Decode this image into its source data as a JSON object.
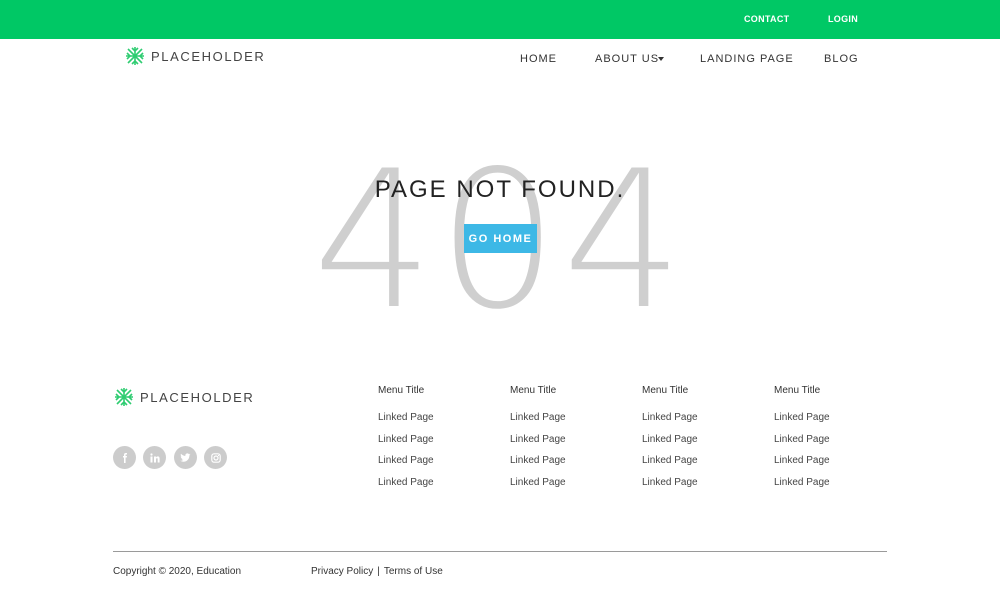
{
  "topbar": {
    "contact": "CONTACT",
    "login": "LOGIN"
  },
  "brand": {
    "name": "PLACEHOLDER",
    "icon": "logo-snowflake-icon"
  },
  "nav": {
    "items": [
      {
        "label": "HOME"
      },
      {
        "label": "ABOUT US",
        "icon": "caret-down-icon"
      },
      {
        "label": "LANDING PAGE"
      },
      {
        "label": "BLOG"
      }
    ]
  },
  "hero": {
    "code": "404",
    "message": "PAGE NOT FOUND.",
    "button": "GO HOME"
  },
  "social": [
    "facebook-icon",
    "linkedin-icon",
    "twitter-icon",
    "instagram-icon"
  ],
  "footer": {
    "columns": [
      {
        "title": "Menu Title",
        "links": [
          "Linked Page",
          "Linked Page",
          "Linked Page",
          "Linked Page"
        ]
      },
      {
        "title": "Menu Title",
        "links": [
          "Linked Page",
          "Linked Page",
          "Linked Page",
          "Linked Page"
        ]
      },
      {
        "title": "Menu Title",
        "links": [
          "Linked Page",
          "Linked Page",
          "Linked Page",
          "Linked Page"
        ]
      },
      {
        "title": "Menu Title",
        "links": [
          "Linked Page",
          "Linked Page",
          "Linked Page",
          "Linked Page"
        ]
      }
    ],
    "copyright": "Copyright © 2020, Education",
    "privacy": "Privacy Policy",
    "separator": "|",
    "terms": "Terms of Use"
  },
  "colors": {
    "topbar": "#00c865",
    "button": "#3db8e6",
    "big_code": "#cfcfcf",
    "logo": "#2ecc71"
  }
}
